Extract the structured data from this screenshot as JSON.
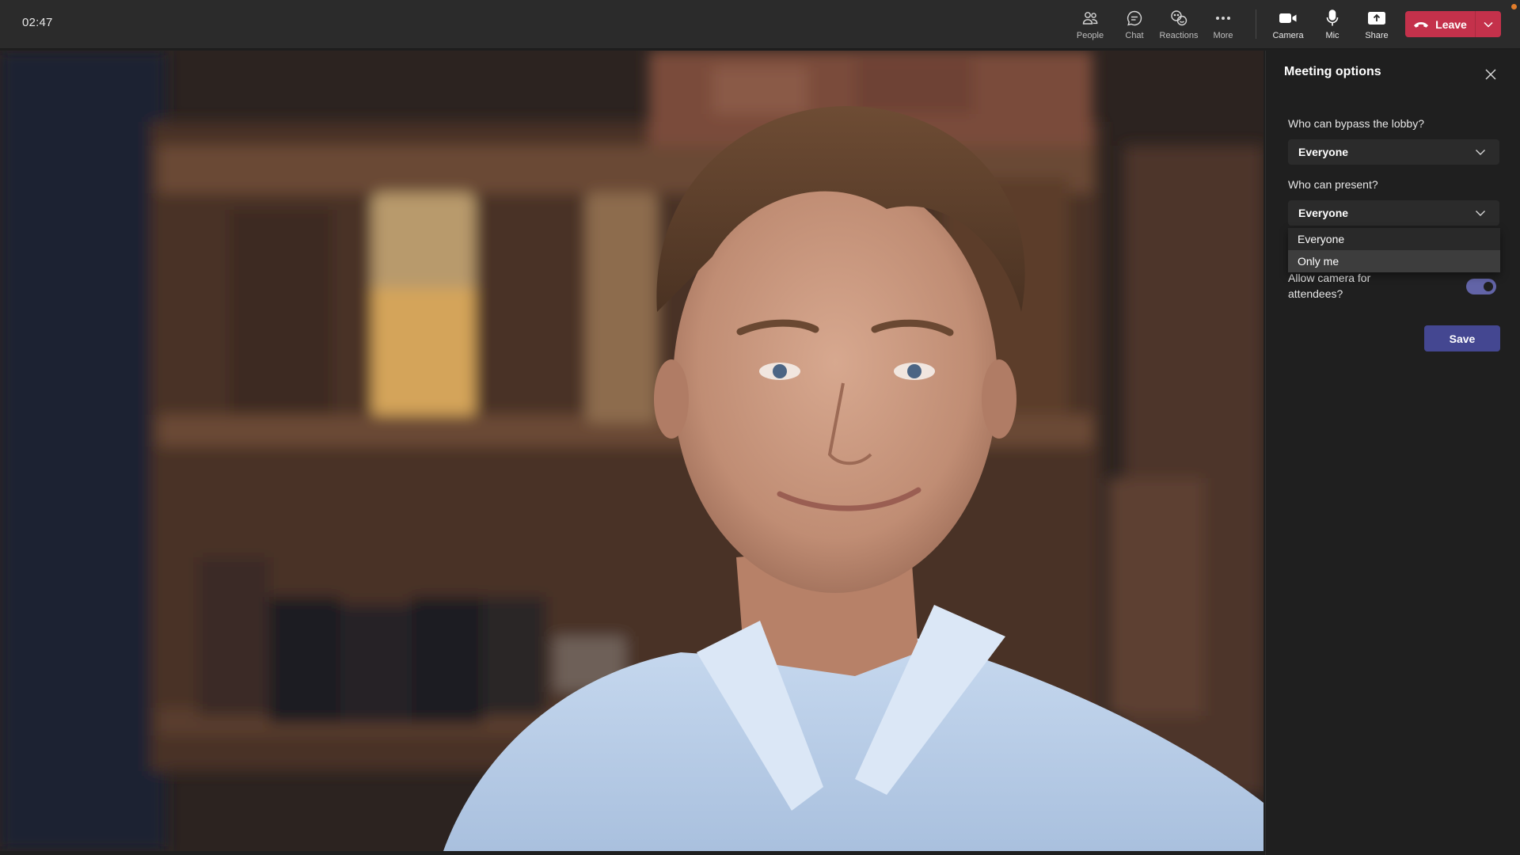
{
  "topbar": {
    "timer": "02:47",
    "buttons": {
      "people": {
        "label": "People",
        "icon": "people-icon"
      },
      "chat": {
        "label": "Chat",
        "icon": "chat-icon"
      },
      "reactions": {
        "label": "Reactions",
        "icon": "reactions-icon"
      },
      "more": {
        "label": "More",
        "icon": "more-icon"
      },
      "camera": {
        "label": "Camera",
        "icon": "camera-icon"
      },
      "mic": {
        "label": "Mic",
        "icon": "mic-icon"
      },
      "share": {
        "label": "Share",
        "icon": "share-icon"
      }
    },
    "leave": {
      "label": "Leave",
      "icon": "phone-hangup-icon"
    }
  },
  "panel": {
    "title": "Meeting options",
    "lobby": {
      "question": "Who can bypass the lobby?",
      "value": "Everyone"
    },
    "present": {
      "question": "Who can present?",
      "value": "Everyone",
      "options": [
        "Everyone",
        "Only me"
      ],
      "highlighted_option": "Only me"
    },
    "camera": {
      "question": "Allow camera for attendees?",
      "enabled": true
    },
    "save_label": "Save"
  },
  "colors": {
    "leave": "#c4314b",
    "save": "#444791",
    "toggle": "#6264a7",
    "notification_dot": "#e37d2b"
  }
}
